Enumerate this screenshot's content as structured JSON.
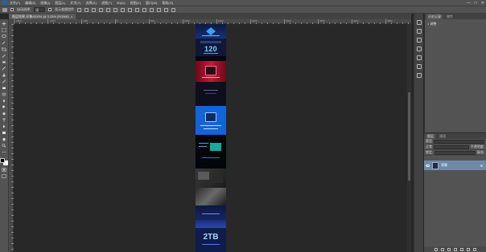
{
  "menubar": {
    "items": [
      "文件(F)",
      "编辑(E)",
      "图像(I)",
      "图层(L)",
      "文字(Y)",
      "选择(S)",
      "滤镜(T)",
      "3D(D)",
      "视图(V)",
      "窗口(W)",
      "帮助(H)"
    ],
    "window_controls": [
      "—",
      "□",
      "✕"
    ]
  },
  "options": {
    "auto_select_label": "自动选择:",
    "auto_select_value": "组",
    "transform_label": "显示变换控件"
  },
  "document": {
    "tab_title": "图层效果-印象/DDR4 @ 3.33% (RGB/8)",
    "close_glyph": "×"
  },
  "ruler": {
    "labels": [
      "-1800",
      "-1200",
      "-600",
      "0",
      "600",
      "1200",
      "1800",
      "2400",
      "3000",
      "3600",
      "4200",
      "4800"
    ]
  },
  "panels": {
    "top_tabs": [
      "历史记录",
      "属性"
    ],
    "top_body": "1 调整"
  },
  "layers": {
    "tabs": [
      "图层",
      "通道"
    ],
    "kind_label": "类型",
    "mode_label": "正常",
    "opacity_label": "不透明度:",
    "lock_label": "锁定:",
    "fill_label": "填充:",
    "layer_name": "背景",
    "layer_badge": "⊕"
  },
  "canvas_art": {
    "big_number_1": "120",
    "big_number_2": "2TB"
  },
  "colors": {
    "chrome": "#535353",
    "workspace": "#282828",
    "layer_selected": "#6e8aa8",
    "accent_blue": "#1463d8"
  }
}
